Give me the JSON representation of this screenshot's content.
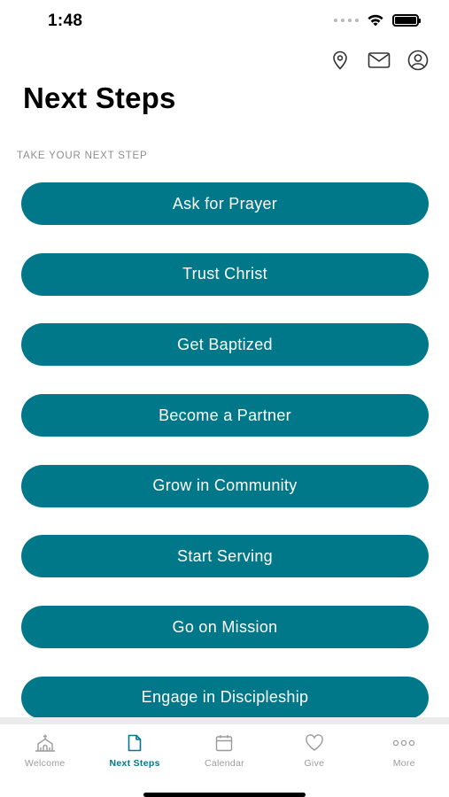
{
  "status_bar": {
    "time": "1:48"
  },
  "top_actions": [
    {
      "name": "location-pin-icon"
    },
    {
      "name": "mail-icon"
    },
    {
      "name": "profile-icon"
    }
  ],
  "page": {
    "title": "Next Steps",
    "section_label": "TAKE YOUR NEXT STEP"
  },
  "steps": [
    {
      "label": "Ask for Prayer"
    },
    {
      "label": "Trust Christ"
    },
    {
      "label": "Get Baptized"
    },
    {
      "label": "Become a Partner"
    },
    {
      "label": "Grow in Community"
    },
    {
      "label": "Start Serving"
    },
    {
      "label": "Go on Mission"
    },
    {
      "label": "Engage in Discipleship"
    }
  ],
  "tabs": [
    {
      "label": "Welcome",
      "icon": "church-icon",
      "active": false
    },
    {
      "label": "Next Steps",
      "icon": "document-icon",
      "active": true
    },
    {
      "label": "Calendar",
      "icon": "calendar-icon",
      "active": false
    },
    {
      "label": "Give",
      "icon": "heart-icon",
      "active": false
    },
    {
      "label": "More",
      "icon": "more-dots-icon",
      "active": false
    }
  ],
  "colors": {
    "accent": "#00788a",
    "inactive": "#9b9b9b",
    "label_gray": "#8e8e8e"
  }
}
